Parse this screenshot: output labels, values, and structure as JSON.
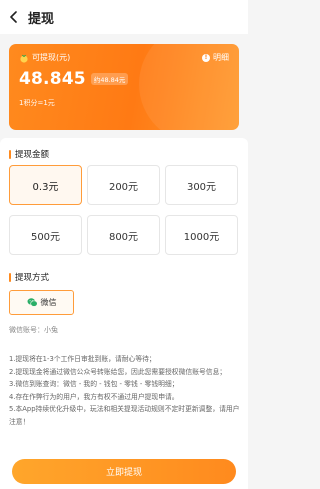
{
  "header": {
    "title": "提现"
  },
  "balance_card": {
    "label": "可提现(元)",
    "detail_label": "明细",
    "amount": "48.845",
    "approx": "约48.84元",
    "rate": "1积分=1元"
  },
  "amount_section": {
    "title": "提现金额",
    "options": [
      "0.3元",
      "200元",
      "300元",
      "500元",
      "800元",
      "1000元"
    ],
    "selected_index": 0
  },
  "method_section": {
    "title": "提现方式",
    "method_label": "微信",
    "account": "微信账号：小兔"
  },
  "notes": [
    "1.提现将在1-3个工作日审批到账，请耐心等待；",
    "2.提现现金将通过微信公众号转账给您，因此您需要授权微信账号信息；",
    "3.微信到账查询：微信 - 我的 - 钱包 - 零钱 - 零钱明细；",
    "4.存在作弊行为的用户，我方有权不通过用户提现申请。",
    "5.本App持续优化升级中，玩法和相关提现活动规则不定时更新调整，请用户注意！"
  ],
  "submit": {
    "label": "立即提现"
  },
  "colors": {
    "accent": "#ff8a1e",
    "wechat": "#2aae67"
  }
}
